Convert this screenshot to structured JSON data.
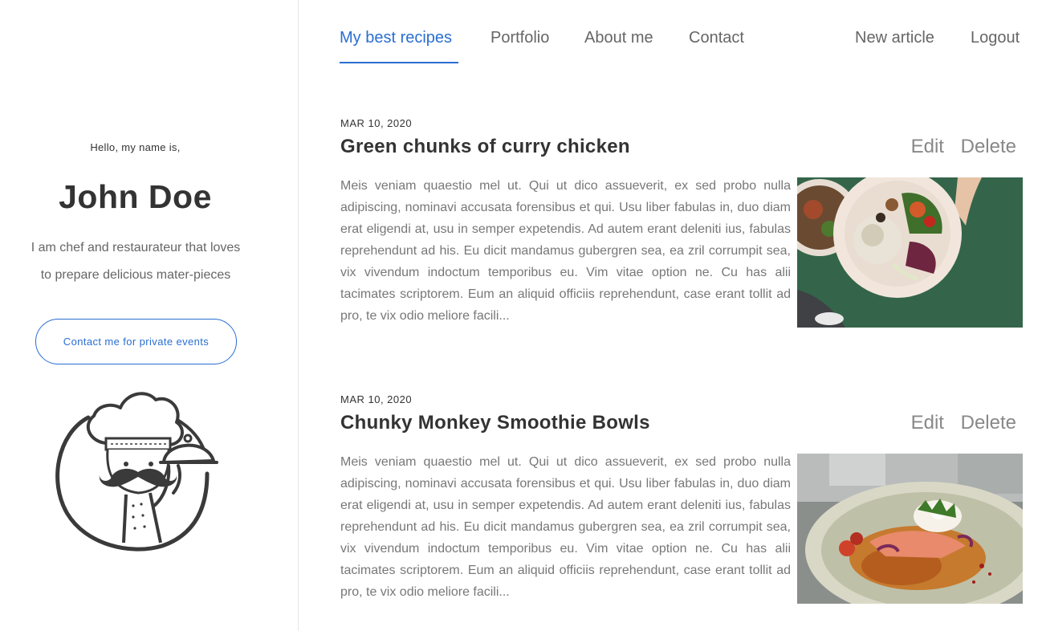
{
  "nav": {
    "items": [
      {
        "label": "My best recipes"
      },
      {
        "label": "Portfolio"
      },
      {
        "label": "About me"
      },
      {
        "label": "Contact"
      }
    ],
    "right": [
      {
        "label": "New article"
      },
      {
        "label": "Logout"
      }
    ]
  },
  "sidebar": {
    "greeting": "Hello, my name is,",
    "name": "John Doe",
    "bio_line1": "I am chef and restaurateur that loves",
    "bio_line2": "to prepare delicious mater-pieces",
    "contact_button": "Contact me for private events"
  },
  "articles": [
    {
      "date": "MAR 10, 2020",
      "title": "Green chunks of curry chicken",
      "edit": "Edit",
      "delete": "Delete",
      "excerpt": "Meis veniam quaestio mel ut. Qui ut dico assueverit, ex sed probo nulla adipiscing, nominavi accusata forensibus et qui. Usu liber fabulas in, duo diam erat eligendi at, usu in semper expetendis. Ad autem erant deleniti ius, fabulas reprehendunt ad his. Eu dicit mandamus gubergren sea, ea zril corrumpit sea, vix vivendum indoctum temporibus eu. Vim vitae option ne. Cu has alii tacimates scriptorem. Eum an aliquid officiis reprehendunt, case erant tollit ad pro, te vix odio meliore facili..."
    },
    {
      "date": "MAR 10, 2020",
      "title": "Chunky Monkey Smoothie Bowls",
      "edit": "Edit",
      "delete": "Delete",
      "excerpt": "Meis veniam quaestio mel ut. Qui ut dico assueverit, ex sed probo nulla adipiscing, nominavi accusata forensibus et qui. Usu liber fabulas in, duo diam erat eligendi at, usu in semper expetendis. Ad autem erant deleniti ius, fabulas reprehendunt ad his. Eu dicit mandamus gubergren sea, ea zril corrumpit sea, vix vivendum indoctum temporibus eu. Vim vitae option ne. Cu has alii tacimates scriptorem. Eum an aliquid officiis reprehendunt, case erant tollit ad pro, te vix odio meliore facili..."
    }
  ],
  "colors": {
    "accent": "#2a6ed1",
    "text": "#333333",
    "muted": "#777777"
  },
  "icons": [
    "chef-logo-icon"
  ]
}
